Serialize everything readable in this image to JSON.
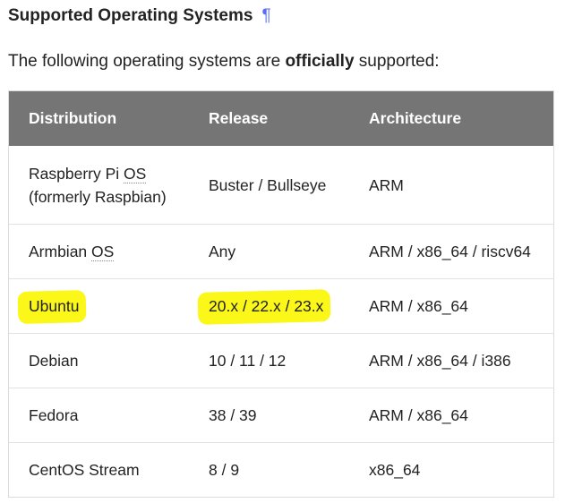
{
  "section": {
    "title": "Supported Operating Systems",
    "anchor_symbol": "¶"
  },
  "intro": {
    "before": "The following operating systems are ",
    "emphasis": "officially",
    "after": " supported:"
  },
  "table": {
    "headers": [
      "Distribution",
      "Release",
      "Architecture"
    ],
    "rows": [
      {
        "distribution_a": "Raspberry Pi ",
        "distribution_abbr": "OS",
        "distribution_b": "(formerly Raspbian)",
        "release": "Buster / Bullseye",
        "architecture": "ARM"
      },
      {
        "distribution_a": "Armbian ",
        "distribution_abbr": "OS",
        "release": "Any",
        "architecture": "ARM / x86_64 / riscv64"
      },
      {
        "distribution": "Ubuntu",
        "release": "20.x / 22.x / 23.x",
        "architecture": "ARM / x86_64"
      },
      {
        "distribution": "Debian",
        "release": "10 / 11 / 12",
        "architecture": "ARM / x86_64 / i386"
      },
      {
        "distribution": "Fedora",
        "release": "38 / 39",
        "architecture": "ARM / x86_64"
      },
      {
        "distribution": "CentOS Stream",
        "release": "8 / 9",
        "architecture": "x86_64"
      }
    ]
  },
  "colors": {
    "header_bg": "#757575",
    "highlight": "#fbf718",
    "anchor": "#5a6cf0"
  }
}
